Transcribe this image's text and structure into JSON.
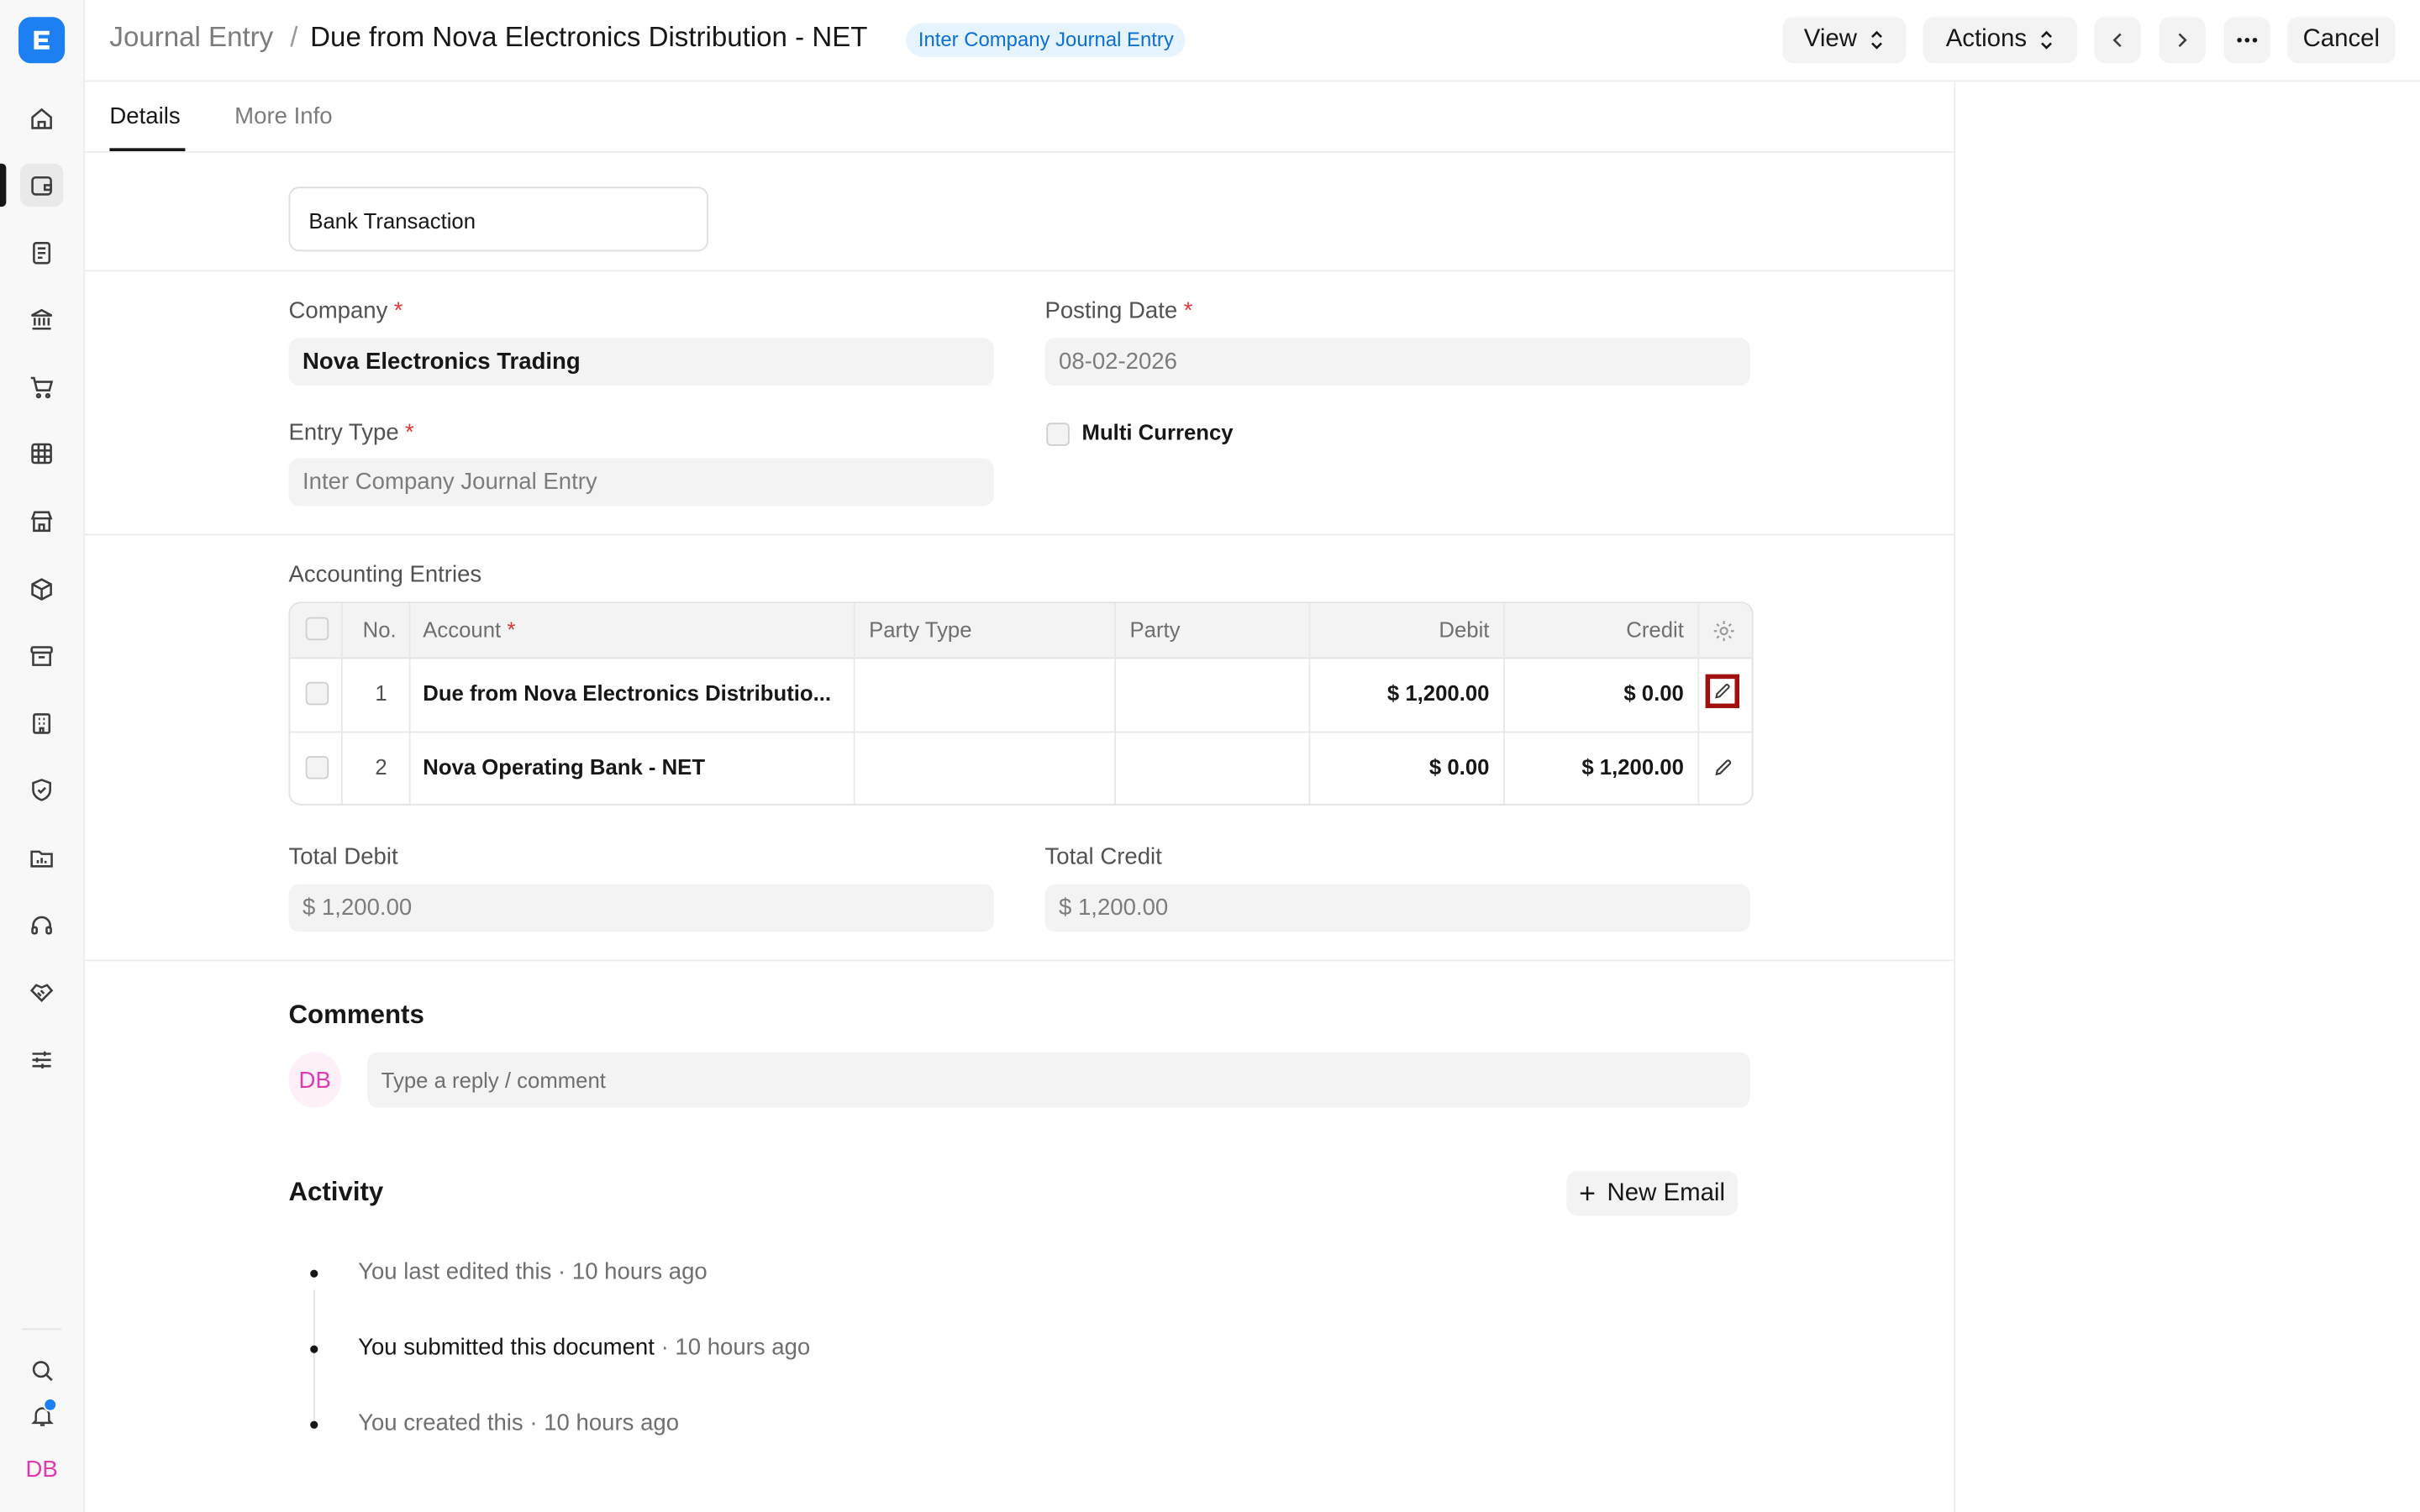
{
  "breadcrumb": {
    "parent": "Journal Entry",
    "separator": "/",
    "title": "Due from Nova Electronics Distribution - NET"
  },
  "status_badge": "Inter Company Journal Entry",
  "header_buttons": {
    "view": "View",
    "actions": "Actions",
    "cancel": "Cancel"
  },
  "tabs": [
    {
      "label": "Details"
    },
    {
      "label": "More Info"
    }
  ],
  "bank_transaction": "Bank Transaction",
  "form": {
    "company": {
      "label": "Company",
      "value": "Nova Electronics Trading"
    },
    "posting_date": {
      "label": "Posting Date",
      "value": "08-02-2026"
    },
    "entry_type": {
      "label": "Entry Type",
      "value": "Inter Company Journal Entry"
    },
    "multi_currency": {
      "label": "Multi Currency",
      "checked": false
    }
  },
  "accounting_entries": {
    "title": "Accounting Entries",
    "columns": [
      "No.",
      "Account",
      "Party Type",
      "Party",
      "Debit",
      "Credit"
    ],
    "rows": [
      {
        "no": "1",
        "account": "Due from Nova Electronics Distributio...",
        "party_type": "",
        "party": "",
        "debit": "$ 1,200.00",
        "credit": "$ 0.00"
      },
      {
        "no": "2",
        "account": "Nova Operating Bank - NET",
        "party_type": "",
        "party": "",
        "debit": "$ 0.00",
        "credit": "$ 1,200.00"
      }
    ]
  },
  "totals": {
    "debit": {
      "label": "Total Debit",
      "value": "$ 1,200.00"
    },
    "credit": {
      "label": "Total Credit",
      "value": "$ 1,200.00"
    }
  },
  "comments": {
    "title": "Comments",
    "avatar": "DB",
    "placeholder": "Type a reply / comment"
  },
  "activity": {
    "title": "Activity",
    "new_email": "New Email",
    "items": [
      {
        "text": "You last edited this",
        "time": " · 10 hours ago"
      },
      {
        "text": "You submitted this document",
        "time": " · 10 hours ago"
      },
      {
        "text": "You created this",
        "time": " · 10 hours ago"
      }
    ]
  },
  "sidebar": {
    "user_initials": "DB"
  },
  "colors": {
    "accent": "#1c7ff2",
    "badge_bg": "#e6f4ff",
    "badge_text": "#0b6fd4",
    "highlight": "#a10f0f",
    "avatar": "#e03ab0"
  }
}
